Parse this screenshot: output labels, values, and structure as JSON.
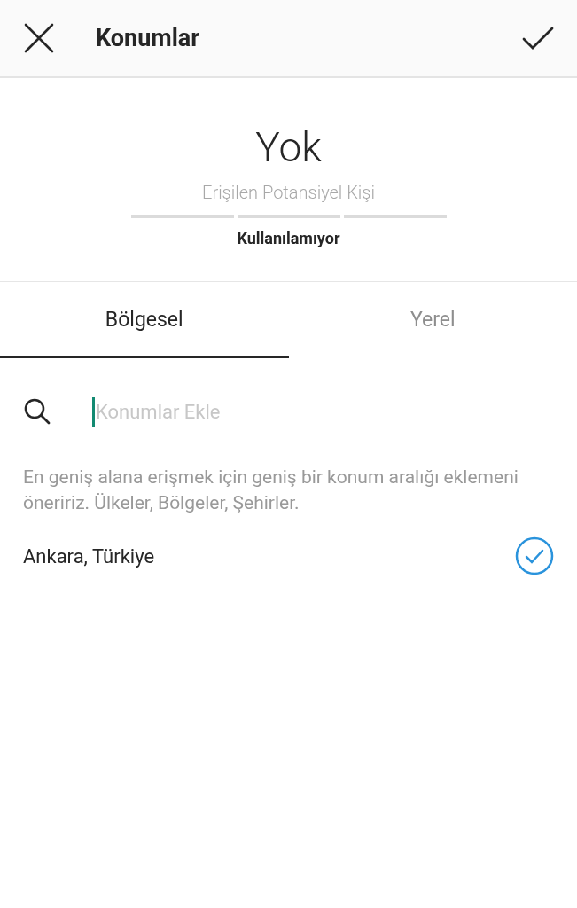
{
  "header": {
    "title": "Konumlar"
  },
  "reach": {
    "value": "Yok",
    "label": "Erişilen Potansiyel Kişi",
    "level": 0,
    "status": "Kullanılamıyor"
  },
  "tabs": [
    {
      "label": "Bölgesel",
      "selected": true
    },
    {
      "label": "Yerel",
      "selected": false
    }
  ],
  "search": {
    "placeholder": "Konumlar Ekle"
  },
  "hint": "En geniş alana erişmek için geniş bir konum aralığı eklemeni öneririz. Ülkeler, Bölgeler, Şehirler.",
  "locations": [
    {
      "name": "Ankara, Türkiye",
      "selected": true
    }
  ]
}
